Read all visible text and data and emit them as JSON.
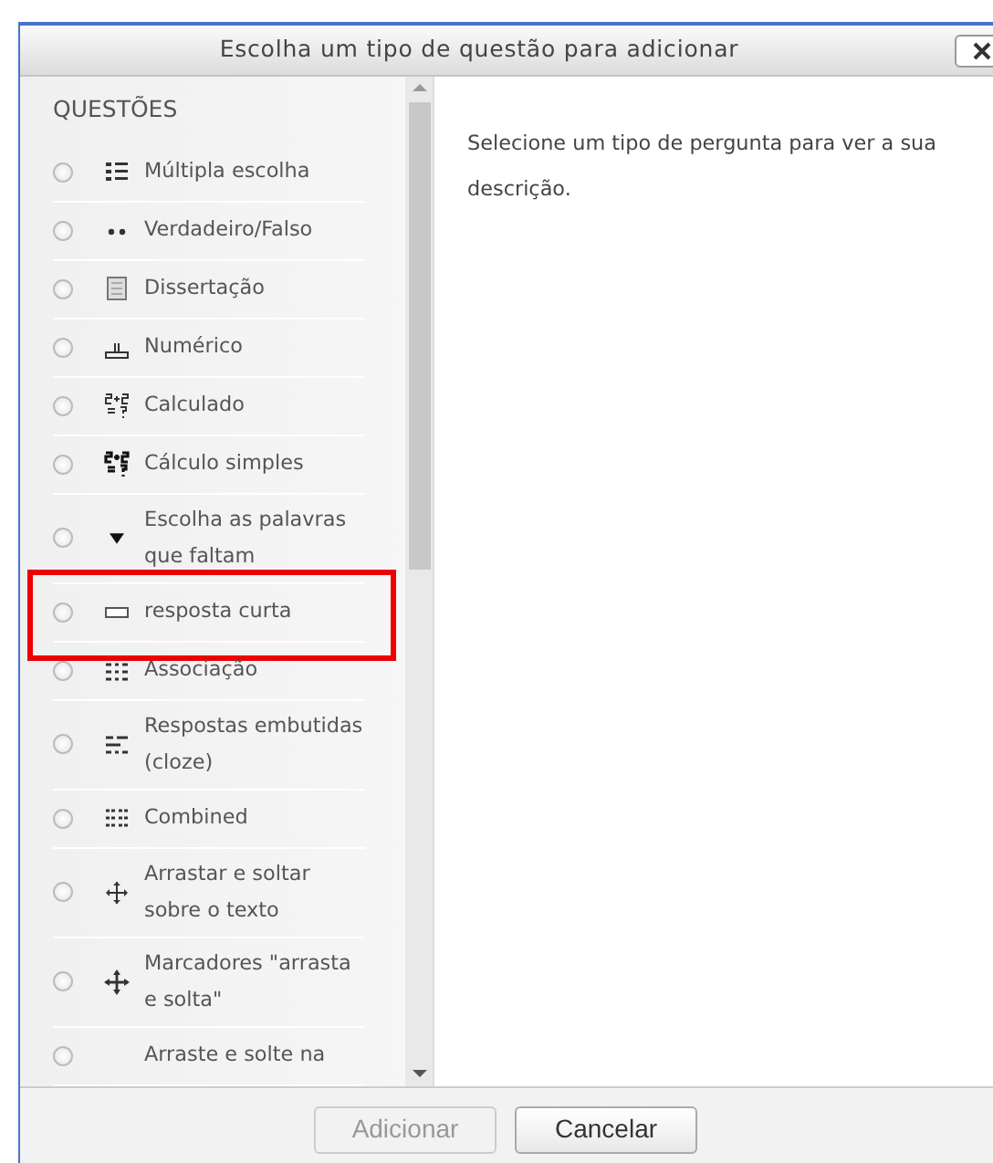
{
  "dialog": {
    "title": "Escolha um tipo de questão para adicionar"
  },
  "question_list": {
    "heading": "QUESTÕES",
    "items": [
      {
        "label": "Múltipla escolha",
        "selected": false,
        "highlighted": false
      },
      {
        "label": "Verdadeiro/Falso",
        "selected": false,
        "highlighted": false
      },
      {
        "label": "Dissertação",
        "selected": false,
        "highlighted": false
      },
      {
        "label": "Numérico",
        "selected": false,
        "highlighted": false
      },
      {
        "label": "Calculado",
        "selected": false,
        "highlighted": false
      },
      {
        "label": "Cálculo simples",
        "selected": false,
        "highlighted": false
      },
      {
        "label": "Escolha as palavras que faltam",
        "selected": false,
        "highlighted": false
      },
      {
        "label": "resposta curta",
        "selected": false,
        "highlighted": true
      },
      {
        "label": "Associação",
        "selected": false,
        "highlighted": false
      },
      {
        "label": "Respostas embutidas (cloze)",
        "selected": false,
        "highlighted": false
      },
      {
        "label": "Combined",
        "selected": false,
        "highlighted": false
      },
      {
        "label": "Arrastar e soltar sobre o texto",
        "selected": false,
        "highlighted": false
      },
      {
        "label": "Marcadores \"arrasta e solta\"",
        "selected": false,
        "highlighted": false
      },
      {
        "label": "Arraste e solte na",
        "selected": false,
        "highlighted": false
      }
    ]
  },
  "description": "Selecione um tipo de pergunta para ver a sua descrição.",
  "buttons": [
    {
      "label": "Adicionar",
      "disabled": true
    },
    {
      "label": "Cancelar",
      "disabled": false
    }
  ]
}
